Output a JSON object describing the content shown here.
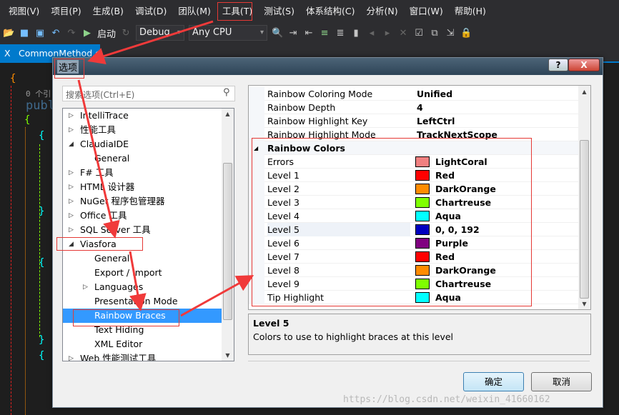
{
  "menubar": [
    "视图(V)",
    "项目(P)",
    "生成(B)",
    "调试(D)",
    "团队(M)",
    "工具(T)",
    "测试(S)",
    "体系结构(C)",
    "分析(N)",
    "窗口(W)",
    "帮助(H)"
  ],
  "toolbar": {
    "start": "启动",
    "config": "Debug",
    "platform": "Any CPU"
  },
  "tab": {
    "label": "CommonMethod.cs",
    "close": "X"
  },
  "editor": {
    "refs": "0 个引",
    "line": "publi"
  },
  "dialog": {
    "title": "选项",
    "help": "?",
    "close": "X",
    "search_placeholder": "搜索选项(Ctrl+E)",
    "tree": [
      {
        "label": "IntelliTrace",
        "level": 0,
        "state": "collapsed"
      },
      {
        "label": "性能工具",
        "level": 0,
        "state": "collapsed"
      },
      {
        "label": "ClaudiaIDE",
        "level": 0,
        "state": "expanded"
      },
      {
        "label": "General",
        "level": 1
      },
      {
        "label": "F# 工具",
        "level": 0,
        "state": "collapsed"
      },
      {
        "label": "HTML 设计器",
        "level": 0,
        "state": "collapsed"
      },
      {
        "label": "NuGet 程序包管理器",
        "level": 0,
        "state": "collapsed"
      },
      {
        "label": "Office 工具",
        "level": 0,
        "state": "collapsed"
      },
      {
        "label": "SQL Server 工具",
        "level": 0,
        "state": "collapsed"
      },
      {
        "label": "Viasfora",
        "level": 0,
        "state": "expanded"
      },
      {
        "label": "General",
        "level": 1
      },
      {
        "label": "Export / Import",
        "level": 1
      },
      {
        "label": "Languages",
        "level": 1,
        "state": "collapsed"
      },
      {
        "label": "Presentation Mode",
        "level": 1
      },
      {
        "label": "Rainbow Braces",
        "level": 1,
        "selected": true
      },
      {
        "label": "Text Hiding",
        "level": 1
      },
      {
        "label": "XML Editor",
        "level": 1
      },
      {
        "label": "Web 性能测试工具",
        "level": 0,
        "state": "collapsed"
      }
    ],
    "properties": [
      {
        "name": "Rainbow Coloring Mode",
        "value": "Unified"
      },
      {
        "name": "Rainbow Depth",
        "value": "4"
      },
      {
        "name": "Rainbow Highlight Key",
        "value": "LeftCtrl"
      },
      {
        "name": "Rainbow Highlight Mode",
        "value": "TrackNextScope"
      }
    ],
    "category": "Rainbow Colors",
    "colors": [
      {
        "name": "Errors",
        "value": "LightCoral",
        "hex": "#f08080"
      },
      {
        "name": "Level 1",
        "value": "Red",
        "hex": "#ff0000"
      },
      {
        "name": "Level 2",
        "value": "DarkOrange",
        "hex": "#ff8c00"
      },
      {
        "name": "Level 3",
        "value": "Chartreuse",
        "hex": "#7fff00"
      },
      {
        "name": "Level 4",
        "value": "Aqua",
        "hex": "#00ffff"
      },
      {
        "name": "Level 5",
        "value": "0, 0, 192",
        "hex": "#0000c0",
        "selected": true
      },
      {
        "name": "Level 6",
        "value": "Purple",
        "hex": "#800080"
      },
      {
        "name": "Level 7",
        "value": "Red",
        "hex": "#ff0000"
      },
      {
        "name": "Level 8",
        "value": "DarkOrange",
        "hex": "#ff8c00"
      },
      {
        "name": "Level 9",
        "value": "Chartreuse",
        "hex": "#7fff00"
      },
      {
        "name": "Tip Highlight",
        "value": "Aqua",
        "hex": "#00ffff"
      }
    ],
    "description": {
      "title": "Level 5",
      "text": "Colors to use to highlight braces at this level"
    },
    "ok": "确定",
    "cancel": "取消"
  },
  "watermark": "https://blog.csdn.net/weixin_41660162",
  "colors": {
    "accent": "#007acc",
    "selection": "#3399ff",
    "annotation": "#e53935"
  }
}
